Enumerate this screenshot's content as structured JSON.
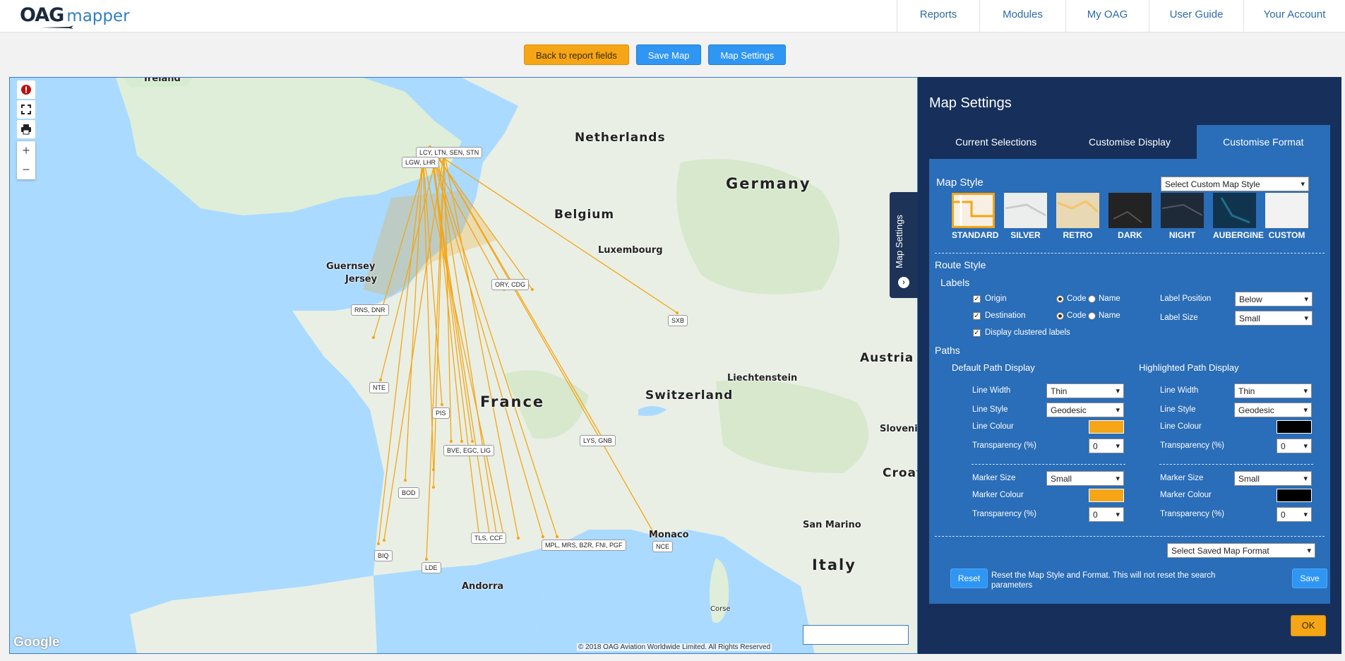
{
  "app": {
    "logo_main": "OAG",
    "logo_sub": "mapper"
  },
  "nav": {
    "items": [
      "Reports",
      "Modules",
      "My OAG",
      "User Guide",
      "Your Account"
    ]
  },
  "actions": {
    "back": "Back to report fields",
    "save_map": "Save Map",
    "map_settings": "Map Settings"
  },
  "map": {
    "countries": {
      "ireland": "Ireland",
      "netherlands": "Netherlands",
      "germany": "Germany",
      "belgium": "Belgium",
      "luxembourg": "Luxembourg",
      "guernsey": "Guernsey",
      "jersey": "Jersey",
      "france": "France",
      "switzerland": "Switzerland",
      "liechtenstein": "Liechtenstein",
      "austria": "Austria",
      "slovenia": "Sloveni",
      "croatia": "Croat",
      "monaco": "Monaco",
      "san_marino": "San Marino",
      "italy": "Italy",
      "andorra": "Andorra",
      "corse": "Corse"
    },
    "airports": {
      "lcy": "LCY, LTN, SEN, STN",
      "lgw": "LGW, LHR",
      "ory": "ORY, CDG",
      "rns": "RNS, DNR",
      "sxb": "SXB",
      "nte": "NTE",
      "pis": "PIS",
      "bve": "BVE, EGC, LIG",
      "lys": "LYS, GNB",
      "bod": "BOD",
      "tls": "TLS, CCF",
      "mpl": "MPL, MRS, BZR, FNI, PGF",
      "nce": "NCE",
      "biq": "BIQ",
      "lde": "LDE"
    },
    "google": "Google",
    "copyright": "© 2018 OAG Aviation Worldwide Limited. All Rights Reserved",
    "route_color": "#f5a515"
  },
  "side_tab": {
    "label": "Map Settings"
  },
  "panel": {
    "title": "Map Settings",
    "tabs": [
      "Current Selections",
      "Customise Display",
      "Customise Format"
    ],
    "map_style": {
      "heading": "Map Style",
      "custom_select": "Select Custom Map Style",
      "styles": [
        "STANDARD",
        "SILVER",
        "RETRO",
        "DARK",
        "NIGHT",
        "AUBERGINE",
        "CUSTOM"
      ]
    },
    "route_style": {
      "heading": "Route Style",
      "labels_heading": "Labels",
      "origin": "Origin",
      "destination": "Destination",
      "clustered": "Display clustered labels",
      "code": "Code",
      "name": "Name",
      "label_position": "Label Position",
      "label_position_value": "Below",
      "label_size": "Label Size",
      "label_size_value": "Small"
    },
    "paths": {
      "heading": "Paths",
      "default_heading": "Default Path Display",
      "highlight_heading": "Highlighted Path Display",
      "line_width": "Line Width",
      "line_style": "Line Style",
      "line_colour": "Line Colour",
      "transparency": "Transparency (%)",
      "marker_size": "Marker Size",
      "marker_colour": "Marker Colour",
      "default": {
        "line_width": "Thin",
        "line_style": "Geodesic",
        "line_colour": "#f5a515",
        "transparency": "0",
        "marker_size": "Small",
        "marker_colour": "#f5a515",
        "marker_transparency": "0"
      },
      "highlight": {
        "line_width": "Thin",
        "line_style": "Geodesic",
        "line_colour": "#000000",
        "transparency": "0",
        "marker_size": "Small",
        "marker_colour": "#000000",
        "marker_transparency": "0"
      }
    },
    "saved_format": "Select Saved Map Format",
    "reset": "Reset",
    "reset_text": "Reset the Map Style and Format. This will not reset the search parameters",
    "save": "Save",
    "ok": "OK"
  }
}
